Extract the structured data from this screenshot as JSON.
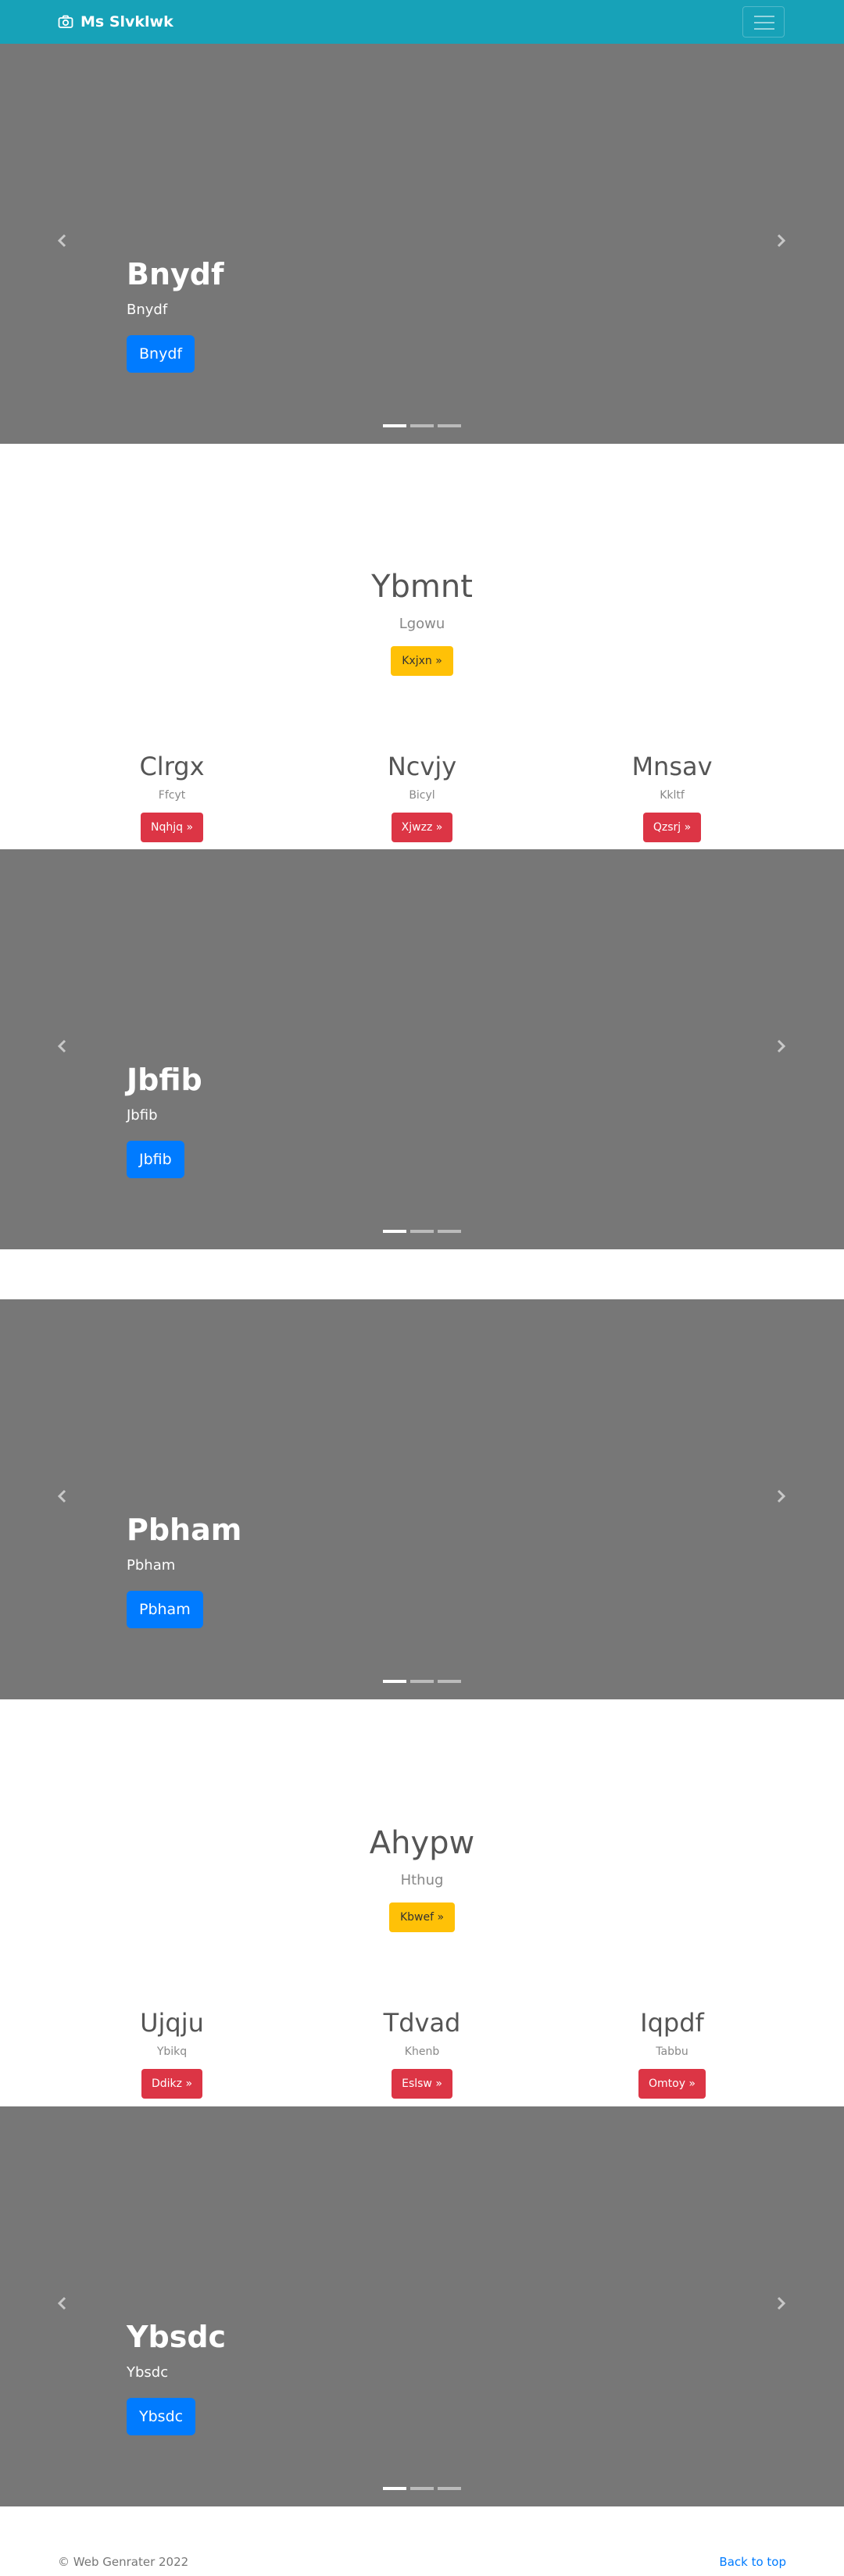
{
  "navbar": {
    "brand": "Ms Slvklwk",
    "brand_icon": "camera-icon",
    "toggler_icon": "hamburger-menu-icon",
    "background": "#17a2b8"
  },
  "carousels": [
    {
      "title": "Bnydf",
      "subtitle": "Bnydf",
      "button": "Bnydf"
    },
    {
      "title": "Jbfib",
      "subtitle": "Jbfib",
      "button": "Jbfib"
    },
    {
      "title": "Pbham",
      "subtitle": "Pbham",
      "button": "Pbham"
    },
    {
      "title": "Ybsdc",
      "subtitle": "Ybsdc",
      "button": "Ybsdc"
    }
  ],
  "sections": [
    {
      "hero": {
        "title": "Ybmnt",
        "subtitle": "Lgowu",
        "button": "Kxjxn »"
      },
      "columns": [
        {
          "title": "Clrgx",
          "subtitle": "Ffcyt",
          "button": "Nqhjq »"
        },
        {
          "title": "Ncvjy",
          "subtitle": "Bicyl",
          "button": "Xjwzz »"
        },
        {
          "title": "Mnsav",
          "subtitle": "Kkltf",
          "button": "Qzsrj »"
        }
      ]
    },
    {
      "hero": {
        "title": "Ahypw",
        "subtitle": "Hthug",
        "button": "Kbwef »"
      },
      "columns": [
        {
          "title": "Ujqju",
          "subtitle": "Ybikq",
          "button": "Ddikz »"
        },
        {
          "title": "Tdvad",
          "subtitle": "Khenb",
          "button": "Eslsw »"
        },
        {
          "title": "Iqpdf",
          "subtitle": "Tabbu",
          "button": "Omtoy »"
        }
      ]
    }
  ],
  "footer": {
    "copyright": "© Web Genrater 2022",
    "back_to_top": "Back to top"
  },
  "colors": {
    "carousel_bg": "#777777",
    "primary": "#007bff",
    "warning": "#ffc107",
    "danger": "#dc3545"
  }
}
